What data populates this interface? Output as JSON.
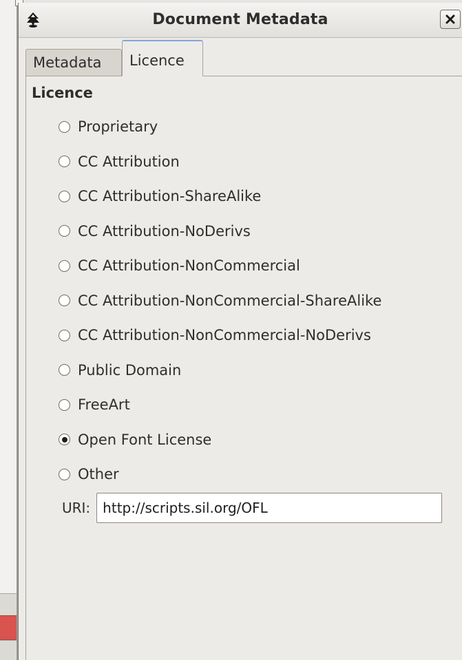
{
  "window": {
    "title": "Document Metadata",
    "icon": "inkscape-logo-icon",
    "close_icon": "close-icon"
  },
  "tabs": [
    {
      "label": "Metadata",
      "active": false
    },
    {
      "label": "Licence",
      "active": true
    }
  ],
  "licence": {
    "section_title": "Licence",
    "options": [
      {
        "label": "Proprietary",
        "selected": false
      },
      {
        "label": "CC Attribution",
        "selected": false
      },
      {
        "label": "CC Attribution-ShareAlike",
        "selected": false
      },
      {
        "label": "CC Attribution-NoDerivs",
        "selected": false
      },
      {
        "label": "CC Attribution-NonCommercial",
        "selected": false
      },
      {
        "label": "CC Attribution-NonCommercial-ShareAlike",
        "selected": false
      },
      {
        "label": "CC Attribution-NonCommercial-NoDerivs",
        "selected": false
      },
      {
        "label": "Public Domain",
        "selected": false
      },
      {
        "label": "FreeArt",
        "selected": false
      },
      {
        "label": "Open Font License",
        "selected": true
      },
      {
        "label": "Other",
        "selected": false
      }
    ],
    "uri_label": "URI:",
    "uri_value": "http://scripts.sil.org/OFL"
  },
  "colors": {
    "selected_tab_accent": "#7fa7d7",
    "background_strip_accent": "#d9534f"
  }
}
